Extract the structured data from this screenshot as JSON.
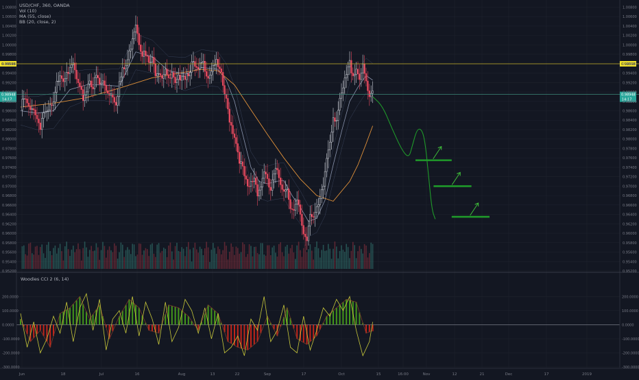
{
  "legend": {
    "symbol": "USD/CHF, 360, OANDA",
    "vol": "Vol (10)",
    "ma": "MA (55, close)",
    "bb": "BB (20, close, 2)",
    "cci": "Woodies CCI 2 (6, 14)"
  },
  "colors": {
    "background": "#131722",
    "grid": "#1e222d",
    "axis_text": "#787b86",
    "up": "#d1d4dc",
    "up_fill": "#131722",
    "down": "#e84a5f",
    "ma": "#e0913a",
    "bb": "#5b6c8f",
    "resistance": "#c9b22a",
    "current": "#3d8a7a",
    "resistance_label": "#f5e52a",
    "current_label": "#26a69a",
    "forecast": "#1f9a2a",
    "cci_up": "#4caf1a",
    "cci_down": "#e0281a",
    "cci_fast": "#c9c93a",
    "volume_up": "#2f6b66",
    "volume_down": "#7a2d3a"
  },
  "chart_data": [
    {
      "type": "candlestick",
      "title": "USD/CHF, 360, OANDA",
      "ylim": [
        0.952,
        1.0085
      ],
      "y_ticks": [
        "1.00800",
        "1.00600",
        "1.00400",
        "1.00200",
        "1.00000",
        "0.99800",
        "0.99600",
        "0.99400",
        "0.99200",
        "0.99000",
        "0.98800",
        "0.98600",
        "0.98400",
        "0.98200",
        "0.98000",
        "0.97800",
        "0.97600",
        "0.97400",
        "0.97200",
        "0.97000",
        "0.96800",
        "0.96600",
        "0.96400",
        "0.96200",
        "0.96000",
        "0.95800",
        "0.95600",
        "0.95400",
        "0.95200"
      ],
      "x_ticks": [
        "Jun",
        "18",
        "Jul",
        "16",
        "Aug",
        "13",
        "22",
        "Sep",
        "17",
        "Oct",
        "15",
        "16:00",
        "Nov",
        "12",
        "21",
        "Dec",
        "17",
        "2019"
      ],
      "price_labels": {
        "resistance": {
          "value": 0.99598,
          "text": "0.99598"
        },
        "current": {
          "value": 0.98948,
          "text": "0.98948",
          "countdown": "14:17"
        }
      },
      "close_path": [
        [
          0,
          0.9862
        ],
        [
          2,
          0.9885
        ],
        [
          4,
          0.9872
        ],
        [
          6,
          0.9855
        ],
        [
          8,
          0.987
        ],
        [
          10,
          0.9843
        ],
        [
          12,
          0.983
        ],
        [
          14,
          0.9858
        ],
        [
          16,
          0.9848
        ],
        [
          18,
          0.9865
        ],
        [
          20,
          0.987
        ],
        [
          22,
          0.9915
        ],
        [
          24,
          0.9945
        ],
        [
          26,
          0.9928
        ],
        [
          28,
          0.9952
        ],
        [
          30,
          0.994
        ],
        [
          32,
          0.9958
        ],
        [
          34,
          0.9925
        ],
        [
          36,
          0.99
        ],
        [
          38,
          0.9888
        ],
        [
          40,
          0.9905
        ],
        [
          42,
          0.993
        ],
        [
          44,
          0.991
        ],
        [
          46,
          0.9932
        ],
        [
          48,
          0.9915
        ],
        [
          50,
          0.992
        ],
        [
          52,
          0.9905
        ],
        [
          54,
          0.99
        ],
        [
          56,
          0.9895
        ],
        [
          58,
          0.988
        ],
        [
          60,
          0.992
        ],
        [
          62,
          0.9942
        ],
        [
          64,
          0.9955
        ],
        [
          66,
          0.998
        ],
        [
          68,
          1.002
        ],
        [
          70,
          1.005
        ],
        [
          72,
          1.001
        ],
        [
          74,
          0.9985
        ],
        [
          76,
          0.9975
        ],
        [
          78,
          0.996
        ],
        [
          80,
          0.9965
        ],
        [
          82,
          0.9945
        ],
        [
          84,
          0.995
        ],
        [
          86,
          0.9935
        ],
        [
          88,
          0.9955
        ],
        [
          90,
          0.992
        ],
        [
          92,
          0.9935
        ],
        [
          94,
          0.991
        ],
        [
          96,
          0.9925
        ],
        [
          98,
          0.9945
        ],
        [
          100,
          0.9935
        ],
        [
          102,
          0.9945
        ],
        [
          104,
          0.9958
        ],
        [
          106,
          0.995
        ],
        [
          108,
          0.994
        ],
        [
          110,
          0.996
        ],
        [
          112,
          0.9955
        ],
        [
          114,
          0.9935
        ],
        [
          116,
          0.995
        ],
        [
          118,
          0.9965
        ],
        [
          120,
          0.995
        ],
        [
          122,
          0.993
        ],
        [
          124,
          0.9895
        ],
        [
          126,
          0.986
        ],
        [
          128,
          0.983
        ],
        [
          130,
          0.981
        ],
        [
          132,
          0.9775
        ],
        [
          134,
          0.9745
        ],
        [
          136,
          0.972
        ],
        [
          138,
          0.969
        ],
        [
          140,
          0.9705
        ],
        [
          142,
          0.972
        ],
        [
          144,
          0.969
        ],
        [
          146,
          0.97
        ],
        [
          148,
          0.9735
        ],
        [
          150,
          0.9705
        ],
        [
          152,
          0.969
        ],
        [
          154,
          0.972
        ],
        [
          156,
          0.9735
        ],
        [
          158,
          0.9712
        ],
        [
          160,
          0.969
        ],
        [
          162,
          0.9705
        ],
        [
          164,
          0.965
        ],
        [
          166,
          0.964
        ],
        [
          168,
          0.9665
        ],
        [
          170,
          0.964
        ],
        [
          172,
          0.96
        ],
        [
          174,
          0.959
        ],
        [
          176,
          0.965
        ],
        [
          178,
          0.9635
        ],
        [
          180,
          0.9645
        ],
        [
          182,
          0.9665
        ],
        [
          184,
          0.97
        ],
        [
          186,
          0.976
        ],
        [
          188,
          0.98
        ],
        [
          190,
          0.985
        ],
        [
          192,
          0.9845
        ],
        [
          194,
          0.9875
        ],
        [
          196,
          0.9905
        ],
        [
          198,
          0.9935
        ],
        [
          200,
          0.996
        ],
        [
          202,
          0.994
        ],
        [
          204,
          0.995
        ],
        [
          206,
          0.9935
        ],
        [
          208,
          0.9948
        ],
        [
          210,
          0.992
        ],
        [
          212,
          0.988
        ],
        [
          214,
          0.9895
        ]
      ],
      "moving_average": [
        [
          0,
          0.9868
        ],
        [
          20,
          0.9876
        ],
        [
          40,
          0.9888
        ],
        [
          60,
          0.9908
        ],
        [
          80,
          0.993
        ],
        [
          100,
          0.9942
        ],
        [
          110,
          0.9948
        ],
        [
          120,
          0.9945
        ],
        [
          130,
          0.9915
        ],
        [
          140,
          0.9862
        ],
        [
          150,
          0.981
        ],
        [
          160,
          0.976
        ],
        [
          170,
          0.9715
        ],
        [
          180,
          0.968
        ],
        [
          190,
          0.9668
        ],
        [
          200,
          0.971
        ],
        [
          205,
          0.9745
        ],
        [
          210,
          0.979
        ],
        [
          214,
          0.9828
        ]
      ],
      "bollinger_basis": [
        [
          0,
          0.986
        ],
        [
          10,
          0.9855
        ],
        [
          20,
          0.986
        ],
        [
          30,
          0.9905
        ],
        [
          40,
          0.9915
        ],
        [
          50,
          0.9915
        ],
        [
          60,
          0.9912
        ],
        [
          70,
          0.9985
        ],
        [
          80,
          0.9975
        ],
        [
          90,
          0.9945
        ],
        [
          100,
          0.9938
        ],
        [
          110,
          0.9952
        ],
        [
          120,
          0.9948
        ],
        [
          125,
          0.9925
        ],
        [
          130,
          0.988
        ],
        [
          135,
          0.981
        ],
        [
          140,
          0.974
        ],
        [
          145,
          0.971
        ],
        [
          150,
          0.9705
        ],
        [
          155,
          0.971
        ],
        [
          160,
          0.9712
        ],
        [
          165,
          0.968
        ],
        [
          170,
          0.9655
        ],
        [
          175,
          0.9625
        ],
        [
          180,
          0.9632
        ],
        [
          185,
          0.967
        ],
        [
          190,
          0.9745
        ],
        [
          195,
          0.9815
        ],
        [
          200,
          0.988
        ],
        [
          205,
          0.991
        ],
        [
          210,
          0.9935
        ],
        [
          214,
          0.9925
        ]
      ],
      "forecast": {
        "projection": [
          [
            214,
            0.989
          ],
          [
            220,
            0.987
          ],
          [
            226,
            0.982
          ],
          [
            232,
            0.9775
          ],
          [
            236,
            0.976
          ],
          [
            238,
            0.9785
          ],
          [
            241,
            0.9822
          ],
          [
            244,
            0.982
          ],
          [
            246,
            0.979
          ],
          [
            248,
            0.972
          ],
          [
            250,
            0.965
          ],
          [
            252,
            0.963
          ]
        ],
        "targets": [
          {
            "price": 0.9755,
            "from": 240,
            "to": 262
          },
          {
            "price": 0.97,
            "from": 251,
            "to": 274
          },
          {
            "price": 0.9635,
            "from": 262,
            "to": 285
          }
        ]
      }
    },
    {
      "type": "line",
      "title": "Woodies CCI 2 (6, 14)",
      "ylim": [
        -300,
        250
      ],
      "y_ticks": [
        "200.0000",
        "100.0000",
        "0.0000",
        "-100.0000",
        "-200.0000",
        "-300.0000"
      ],
      "series": [
        {
          "name": "CCI",
          "x": [
            0,
            6,
            12,
            18,
            24,
            30,
            36,
            42,
            48,
            54,
            60,
            66,
            72,
            78,
            84,
            90,
            96,
            102,
            108,
            114,
            120,
            126,
            132,
            138,
            144,
            150,
            156,
            162,
            168,
            174,
            180,
            186,
            192,
            198,
            204,
            210,
            214
          ],
          "values": [
            40,
            -120,
            -40,
            -160,
            80,
            120,
            200,
            40,
            140,
            -100,
            60,
            180,
            120,
            -40,
            -60,
            140,
            120,
            60,
            -40,
            140,
            80,
            -120,
            -160,
            -180,
            -120,
            60,
            -80,
            120,
            -100,
            -140,
            -80,
            60,
            120,
            180,
            160,
            -60,
            -40
          ]
        },
        {
          "name": "TurboCCI",
          "x": [
            0,
            4,
            8,
            12,
            16,
            20,
            24,
            28,
            32,
            36,
            40,
            44,
            48,
            52,
            56,
            60,
            64,
            68,
            72,
            76,
            80,
            84,
            88,
            92,
            96,
            100,
            104,
            108,
            112,
            116,
            120,
            124,
            128,
            132,
            136,
            140,
            144,
            148,
            152,
            156,
            160,
            164,
            168,
            172,
            176,
            180,
            184,
            188,
            192,
            196,
            200,
            204,
            208,
            212,
            214
          ],
          "values": [
            80,
            -160,
            20,
            -200,
            -100,
            60,
            -60,
            160,
            -120,
            120,
            220,
            -40,
            180,
            -180,
            40,
            100,
            -60,
            200,
            -80,
            160,
            40,
            -140,
            160,
            -120,
            -20,
            180,
            100,
            -60,
            120,
            -100,
            80,
            -200,
            -160,
            -80,
            -220,
            40,
            -40,
            200,
            -120,
            -40,
            140,
            -160,
            -200,
            60,
            -180,
            -40,
            120,
            60,
            180,
            100,
            200,
            -40,
            -220,
            -120,
            20
          ]
        }
      ]
    }
  ]
}
